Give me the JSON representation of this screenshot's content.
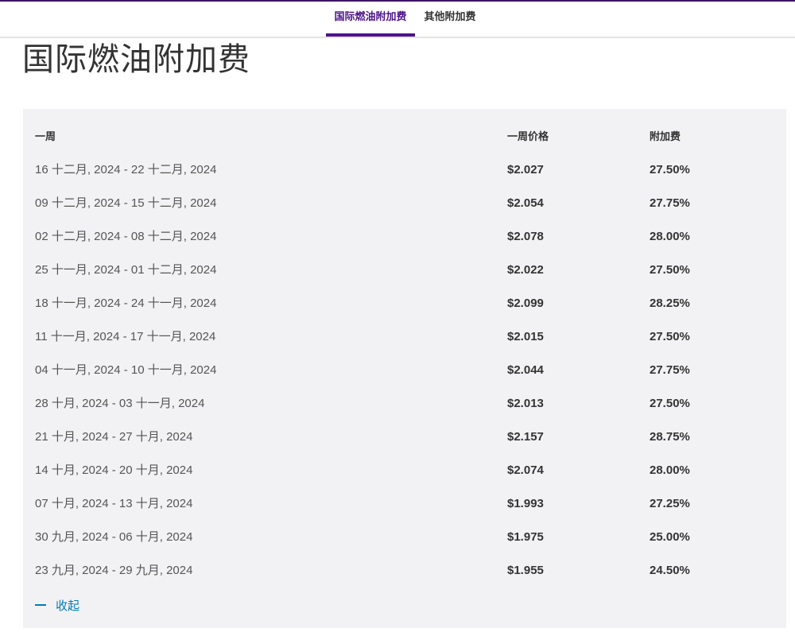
{
  "tabs": [
    {
      "label": "国际燃油附加费",
      "active": true
    },
    {
      "label": "其他附加费",
      "active": false
    }
  ],
  "page": {
    "title": "国际燃油附加费"
  },
  "table": {
    "headers": {
      "week": "一周",
      "price": "一周价格",
      "surcharge": "附加费"
    },
    "rows": [
      {
        "week": "16 十二月, 2024 - 22 十二月, 2024",
        "price": "$2.027",
        "surcharge": "27.50%"
      },
      {
        "week": "09 十二月, 2024 - 15 十二月, 2024",
        "price": "$2.054",
        "surcharge": "27.75%"
      },
      {
        "week": "02 十二月, 2024 - 08 十二月, 2024",
        "price": "$2.078",
        "surcharge": "28.00%"
      },
      {
        "week": "25 十一月, 2024 - 01 十二月, 2024",
        "price": "$2.022",
        "surcharge": "27.50%"
      },
      {
        "week": "18 十一月, 2024 - 24 十一月, 2024",
        "price": "$2.099",
        "surcharge": "28.25%"
      },
      {
        "week": "11 十一月, 2024 - 17 十一月, 2024",
        "price": "$2.015",
        "surcharge": "27.50%"
      },
      {
        "week": "04 十一月, 2024 - 10 十一月, 2024",
        "price": "$2.044",
        "surcharge": "27.75%"
      },
      {
        "week": "28 十月, 2024 - 03 十一月, 2024",
        "price": "$2.013",
        "surcharge": "27.50%"
      },
      {
        "week": "21 十月, 2024 - 27 十月, 2024",
        "price": "$2.157",
        "surcharge": "28.75%"
      },
      {
        "week": "14 十月, 2024 - 20 十月, 2024",
        "price": "$2.074",
        "surcharge": "28.00%"
      },
      {
        "week": "07 十月, 2024 - 13 十月, 2024",
        "price": "$1.993",
        "surcharge": "27.25%"
      },
      {
        "week": "30 九月, 2024 - 06 十月, 2024",
        "price": "$1.975",
        "surcharge": "25.00%"
      },
      {
        "week": "23 九月, 2024 - 29 九月, 2024",
        "price": "$1.955",
        "surcharge": "24.50%"
      }
    ]
  },
  "collapse": {
    "label": "收起",
    "icon": "minus-icon"
  },
  "colors": {
    "accent": "#4d148c",
    "link": "#007ab7",
    "panel_bg": "#f2f2f5"
  }
}
